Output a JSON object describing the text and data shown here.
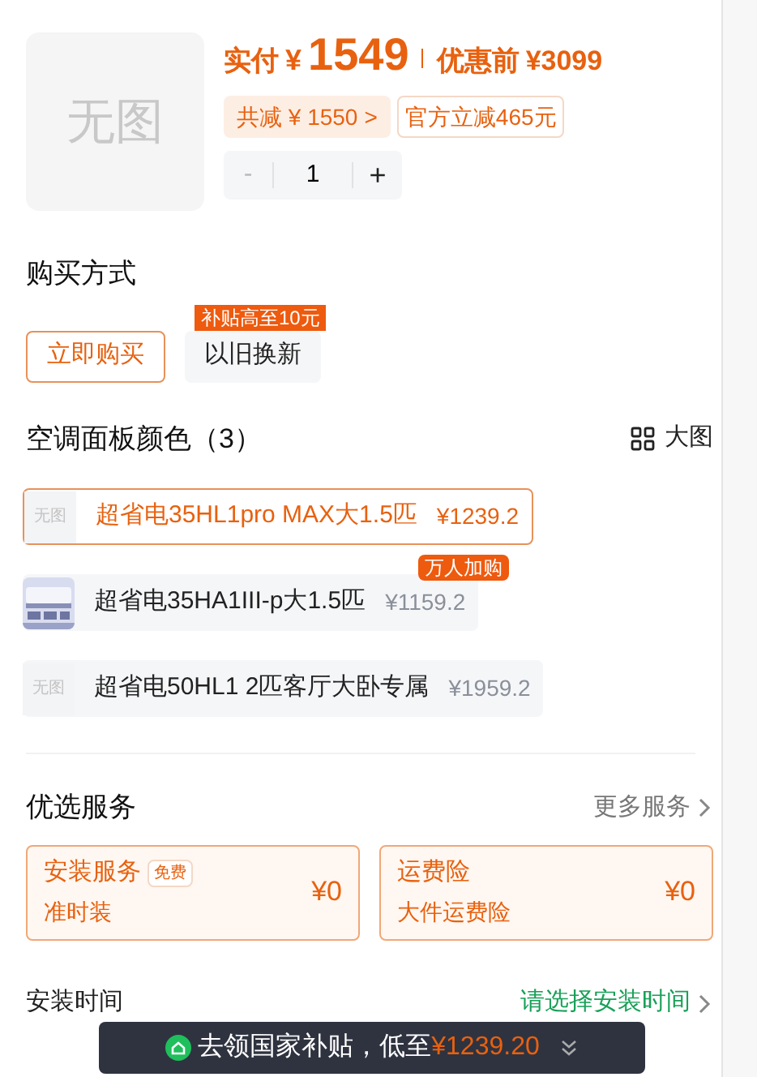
{
  "product": {
    "image_text": "无图",
    "paid_label": "实付",
    "currency": "¥",
    "price": "1549",
    "original_label": "优惠前",
    "original_price": "¥3099",
    "discount": "共减 ¥ 1550",
    "discount_arrow": ">",
    "official_discount": "官方立减465元",
    "quantity": "1",
    "minus": "-",
    "plus": "+",
    "minus_disabled": true
  },
  "purchase": {
    "title": "购买方式",
    "options": [
      {
        "label": "立即购买",
        "selected": true
      },
      {
        "label": "以旧换新",
        "selected": false,
        "badge": "补贴高至10元"
      }
    ]
  },
  "variants": {
    "title": "空调面板颜色（3）",
    "view_label": "大图",
    "items": [
      {
        "kind": "noimage",
        "thumb_text": "无图",
        "name": "超省电35HL1pro MAX大1.5匹",
        "price": "¥1239.2",
        "selected": true
      },
      {
        "kind": "picture",
        "name": "超省电35HA1III-p大1.5匹",
        "price": "¥1159.2",
        "selected": false,
        "badge": "万人加购"
      },
      {
        "kind": "noimage",
        "thumb_text": "无图",
        "name": "超省电50HL1 2匹客厅大卧专属",
        "price": "¥1959.2",
        "selected": false
      }
    ]
  },
  "services": {
    "title": "优选服务",
    "more": "更多服务",
    "cards": [
      {
        "title": "安装服务",
        "tag": "免费",
        "subtitle": "准时装",
        "price": "¥0"
      },
      {
        "title": "运费险",
        "subtitle": "大件运费险",
        "price": "¥0"
      }
    ]
  },
  "rows": [
    {
      "label": "安装时间",
      "value": "请选择安装时间",
      "kind": "select"
    }
  ],
  "toast": {
    "text": "去领国家补贴，低至",
    "price": "¥1239.20"
  }
}
